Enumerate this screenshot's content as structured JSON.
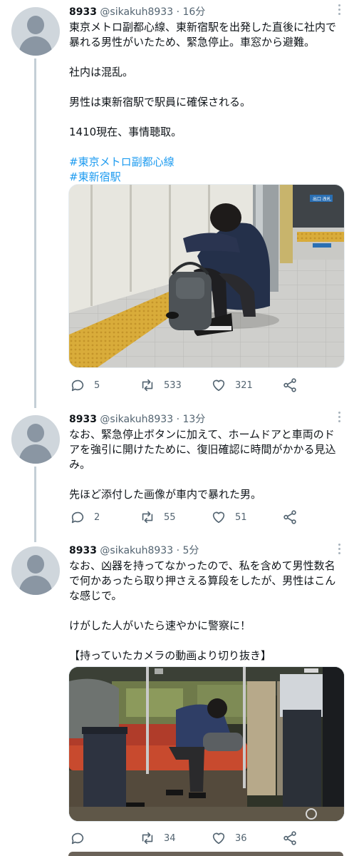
{
  "tweets": [
    {
      "name": "8933",
      "handle": "@sikakuh8933",
      "dot": "·",
      "time": "16分",
      "lines": [
        "東京メトロ副都心線、東新宿駅を出発した直後に社内で",
        "暴れる男性がいたため、緊急停止。車窓から避難。",
        "",
        "社内は混乱。",
        "",
        "男性は東新宿駅で駅員に確保される。",
        "",
        "1410現在、事情聴取。"
      ],
      "hashtags": [
        "#東京メトロ副都心線",
        "#東新宿駅"
      ],
      "reply_count": "5",
      "retweet_count": "533",
      "like_count": "321"
    },
    {
      "name": "8933",
      "handle": "@sikakuh8933",
      "dot": "·",
      "time": "13分",
      "lines": [
        "なお、緊急停止ボタンに加えて、ホームドアと車両のド",
        "アを強引に開けたために、復旧確認に時間がかかる見込",
        "み。",
        "",
        "先ほど添付した画像が車内で暴れた男。"
      ],
      "reply_count": "2",
      "retweet_count": "55",
      "like_count": "51"
    },
    {
      "name": "8933",
      "handle": "@sikakuh8933",
      "dot": "·",
      "time": "5分",
      "lines": [
        "なお、凶器を持ってなかったので、私を含めて男性数名",
        "で何かあったら取り押さえる算段をしたが、男性はこん",
        "な感じで。",
        "",
        "けがした人がいたら速やかに警察に！",
        "",
        "【持っていたカメラの動画より切り抜き】"
      ],
      "reply_count": "",
      "retweet_count": "34",
      "like_count": "36"
    }
  ],
  "photo1": {
    "sign_label": "出口 改札"
  },
  "colors": {
    "text": "#0f1419",
    "muted": "#536471",
    "link": "#1d9bf0",
    "thread": "#c4cfd6"
  }
}
